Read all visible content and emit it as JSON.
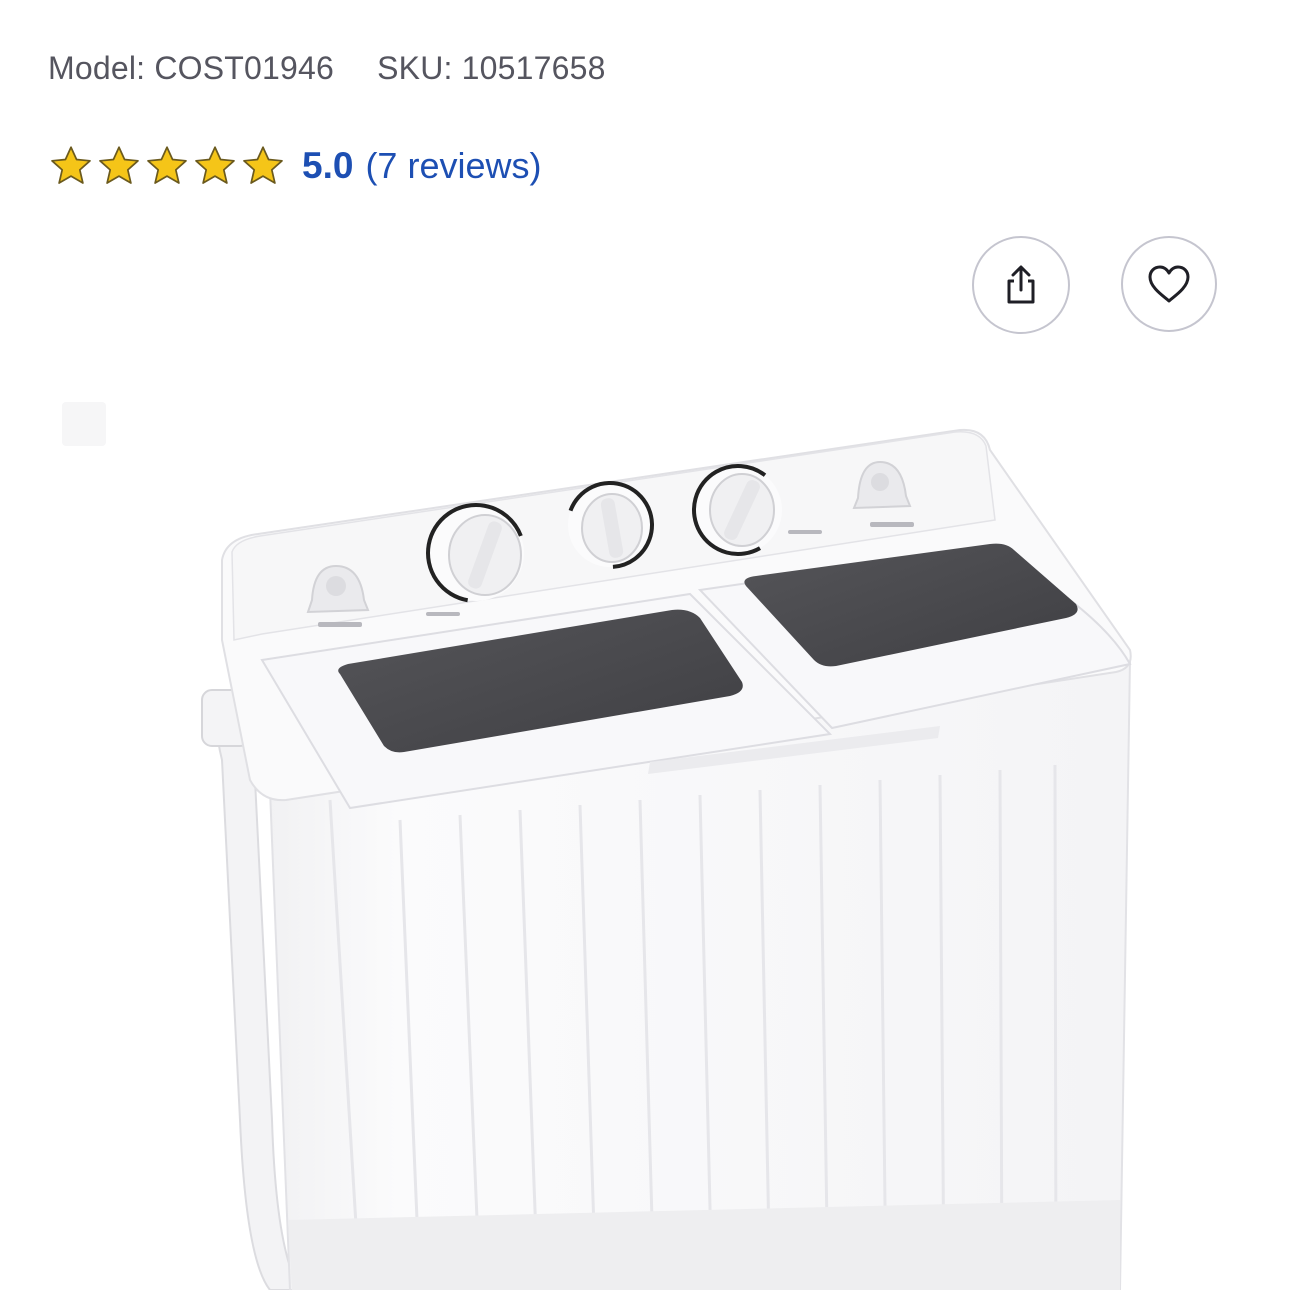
{
  "product": {
    "model_label": "Model: COST01946",
    "sku_label": "SKU: 10517658"
  },
  "rating": {
    "stars_filled": 5,
    "stars_total": 5,
    "value": "5.0",
    "reviews_link": "(7 reviews)",
    "star_color": "#f5c518",
    "link_color": "#1d4fb3"
  },
  "actions": {
    "share_icon": "share-icon",
    "favorite_icon": "heart-icon"
  },
  "image": {
    "subject": "twin-tub portable washing machine",
    "lid_color": "#4a4a4e"
  }
}
